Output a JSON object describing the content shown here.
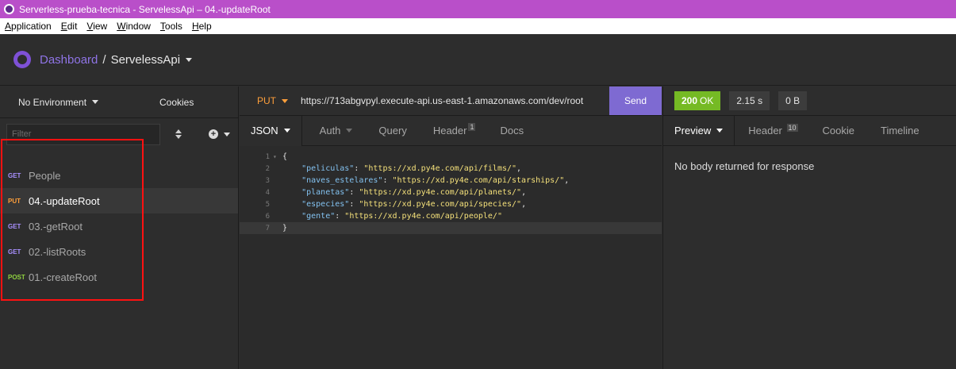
{
  "window": {
    "title": "Serverless-prueba-tecnica - ServelessApi – 04.-updateRoot"
  },
  "menu": [
    "Application",
    "Edit",
    "View",
    "Window",
    "Tools",
    "Help"
  ],
  "header": {
    "dashboard": "Dashboard",
    "separator": "/",
    "workspace": "ServelessApi"
  },
  "sidebar": {
    "environment": "No Environment",
    "cookies": "Cookies",
    "filter_placeholder": "Filter",
    "requests": [
      {
        "method": "GET",
        "name": "People"
      },
      {
        "method": "PUT",
        "name": "04.-updateRoot"
      },
      {
        "method": "GET",
        "name": "03.-getRoot"
      },
      {
        "method": "GET",
        "name": "02.-listRoots"
      },
      {
        "method": "POST",
        "name": "01.-createRoot"
      }
    ]
  },
  "request": {
    "method": "PUT",
    "url": "https://713abgvpyl.execute-api.us-east-1.amazonaws.com/dev/root",
    "send": "Send",
    "tabs": {
      "body": "JSON",
      "auth": "Auth",
      "query": "Query",
      "header": "Header",
      "header_count": "1",
      "docs": "Docs"
    },
    "body_lines": [
      {
        "n": "1",
        "text": "{"
      },
      {
        "n": "2",
        "key": "\"peliculas\"",
        "value": "\"https://xd.py4e.com/api/films/\"",
        "comma": ","
      },
      {
        "n": "3",
        "key": "\"naves_estelares\"",
        "value": "\"https://xd.py4e.com/api/starships/\"",
        "comma": ","
      },
      {
        "n": "4",
        "key": "\"planetas\"",
        "value": "\"https://xd.py4e.com/api/planets/\"",
        "comma": ","
      },
      {
        "n": "5",
        "key": "\"especies\"",
        "value": "\"https://xd.py4e.com/api/species/\"",
        "comma": ","
      },
      {
        "n": "6",
        "key": "\"gente\"",
        "value": "\"https://xd.py4e.com/api/people/\"",
        "comma": ""
      },
      {
        "n": "7",
        "text": "}"
      }
    ]
  },
  "response": {
    "status_code": "200",
    "status_text": "OK",
    "time": "2.15 s",
    "size": "0 B",
    "tabs": {
      "preview": "Preview",
      "header": "Header",
      "header_count": "10",
      "cookie": "Cookie",
      "timeline": "Timeline"
    },
    "empty_message": "No body returned for response"
  },
  "colors": {
    "accent": "#7e6ad2",
    "put": "#ff9f3b",
    "get": "#a990ff",
    "post": "#8fd13f",
    "ok": "#75ba24",
    "highlight": "#ff1111"
  }
}
